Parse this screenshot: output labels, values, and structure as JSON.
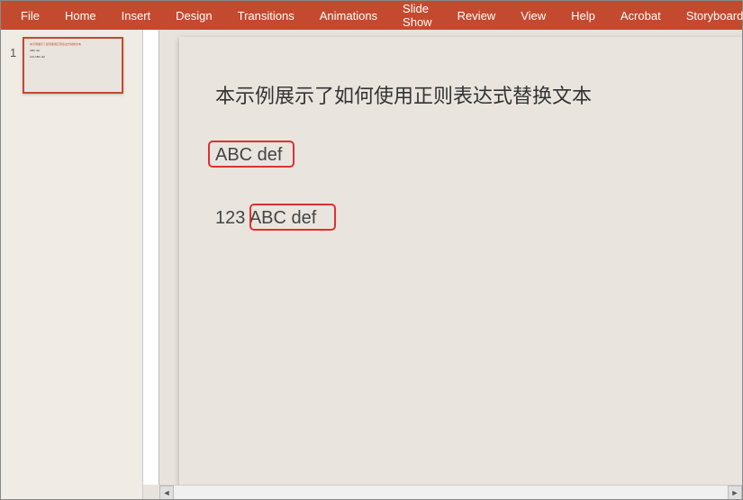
{
  "ribbon": {
    "tabs": [
      "File",
      "Home",
      "Insert",
      "Design",
      "Transitions",
      "Animations",
      "Slide Show",
      "Review",
      "View",
      "Help",
      "Acrobat",
      "Storyboarding"
    ]
  },
  "thumbnails": {
    "items": [
      {
        "number": "1"
      }
    ]
  },
  "slide": {
    "title": "本示例展示了如何使用正则表达式替换文本",
    "line1": "ABC def",
    "line2_prefix": "123 ",
    "line2_highlight": "ABC def"
  },
  "scroll": {
    "left": "◄",
    "right": "►"
  }
}
